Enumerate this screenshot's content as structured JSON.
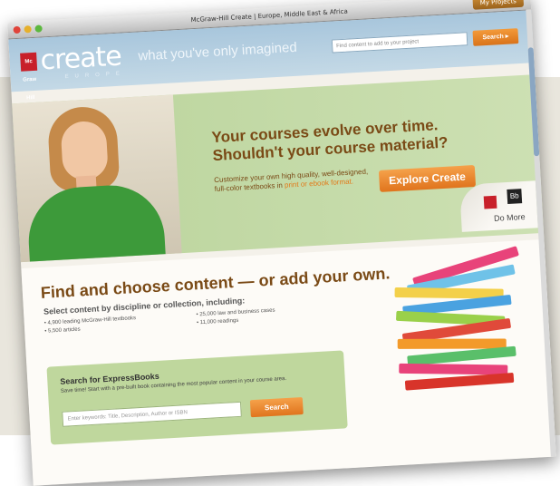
{
  "window": {
    "title": "McGraw-Hill Create | Europe, Middle East & Africa",
    "my_projects": "My Projects"
  },
  "header": {
    "logo_mark": "Mc Graw Hill",
    "logo_word": "create",
    "tagline": "what you've only imagined",
    "region": "EUROPE",
    "search_placeholder": "Find content to add to your project",
    "search_button": "Search ▸"
  },
  "hero": {
    "headline_1": "Your courses evolve over time.",
    "headline_2": "Shouldn't your course material?",
    "body": "Customize your own high quality, well-designed, full-color textbooks in ",
    "body_highlight": "print or ebook format.",
    "cta": "Explore Create",
    "do_more": "Do More",
    "bb_logo": "Bb"
  },
  "find": {
    "headline": "Find and choose content — or add your own.",
    "subhead": "Select content by discipline or collection, including:",
    "items": [
      "• 4,900 leading McGraw-Hill textbooks",
      "• 5,500 articles",
      "• 25,000 law and business cases",
      "• 11,000 readings"
    ]
  },
  "express": {
    "title": "Search for ExpressBooks",
    "body": "Save time! Start with a pre-built book containing the most popular content in your course area.",
    "placeholder": "Enter keywords: Title, Description, Author or ISBN",
    "button": "Search"
  },
  "colors": {
    "accent": "#e0741d",
    "brand_red": "#c8202a",
    "hero_green": "#b9d39a"
  }
}
